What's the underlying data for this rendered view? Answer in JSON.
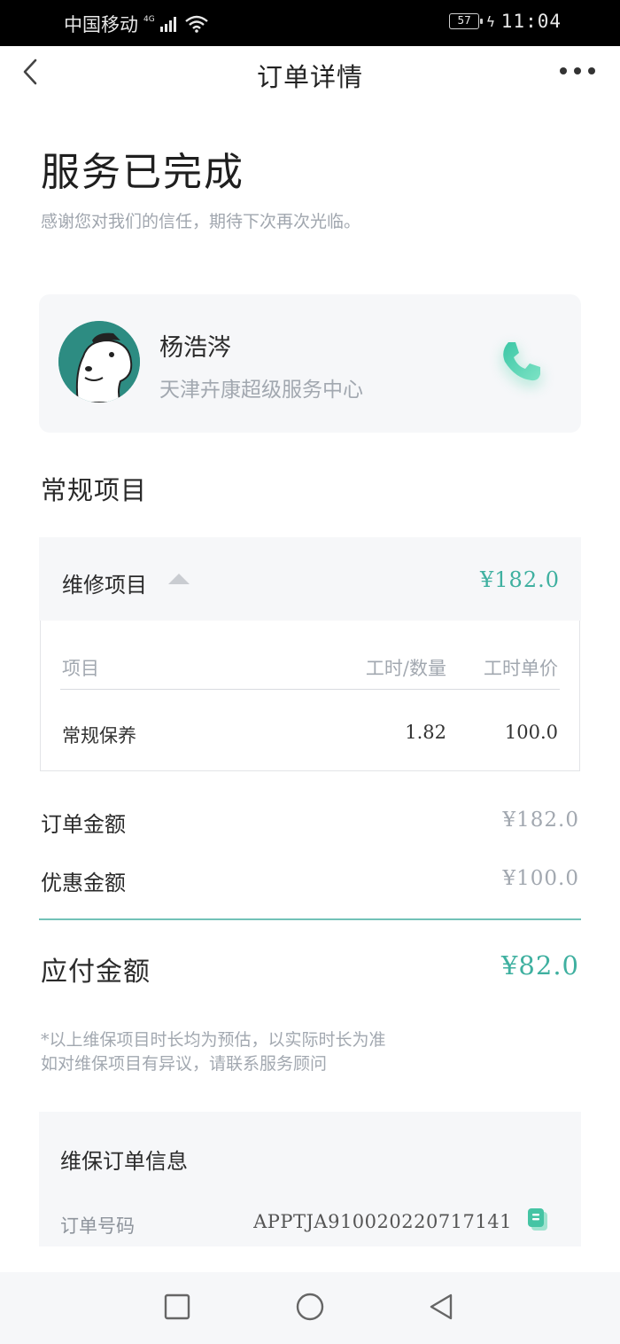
{
  "status_bar": {
    "carrier": "中国移动",
    "network": "4G",
    "battery": "57",
    "time": "11:04"
  },
  "nav": {
    "title": "订单详情"
  },
  "order_status": {
    "title": "服务已完成",
    "subtitle": "感谢您对我们的信任，期待下次再次光临。"
  },
  "advisor": {
    "name": "杨浩涔",
    "org": "天津卉康超级服务中心"
  },
  "regular_items": {
    "section_title": "常规项目",
    "group_label": "维修项目",
    "group_total": "¥182.0",
    "columns": [
      "项目",
      "工时/数量",
      "工时单价"
    ],
    "rows": [
      {
        "item": "常规保养",
        "qty": "1.82",
        "price": "100.0"
      }
    ]
  },
  "summary": {
    "order_amount_label": "订单金额",
    "order_amount": "¥182.0",
    "discount_label": "优惠金额",
    "discount": "¥100.0",
    "payable_label": "应付金额",
    "payable": "¥82.0"
  },
  "notes": [
    "*以上维保项目时长均为预估，以实际时长为准",
    "如对维保项目有异议，请联系服务顾问"
  ],
  "order_info": {
    "title": "维保订单信息",
    "order_no_label": "订单号码",
    "order_no": "APPTJA910020220717141"
  },
  "colors": {
    "accent": "#3fb0a0",
    "card_bg": "#f6f7f9",
    "muted_text": "#a2a8b0"
  },
  "icons": [
    "back-icon",
    "more-icon",
    "phone-icon",
    "caret-up-icon",
    "copy-icon",
    "square-nav-icon",
    "home-circle-icon",
    "back-triangle-icon"
  ]
}
